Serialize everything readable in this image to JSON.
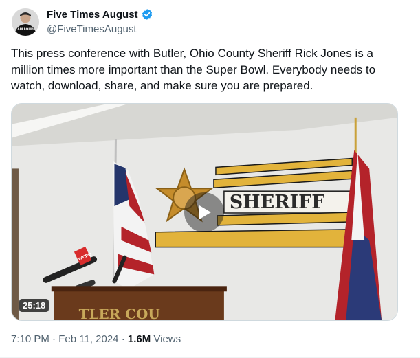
{
  "author": {
    "display_name": "Five Times August",
    "handle": "@FiveTimesAugust",
    "verified": true,
    "avatar_shirt_text": "AM\nLOUD"
  },
  "tweet": {
    "text": "This press conference with Butler, Ohio County Sheriff Rick Jones is a million times more important than the Super Bowl. Everybody needs to watch, download, share, and make sure you are prepared."
  },
  "media": {
    "type": "video",
    "duration": "25:18",
    "scene_wall_text": "SHERIFF",
    "scene_podium_text": "TLER COU",
    "scene_mic_text": "WCPO"
  },
  "meta": {
    "time": "7:10 PM",
    "separator": "·",
    "date": "Feb 11, 2024",
    "views_count": "1.6M",
    "views_label": "Views"
  },
  "colors": {
    "verified_badge": "#1d9bf0",
    "secondary_text": "#536471",
    "stripe_gold": "#e2b33b"
  }
}
